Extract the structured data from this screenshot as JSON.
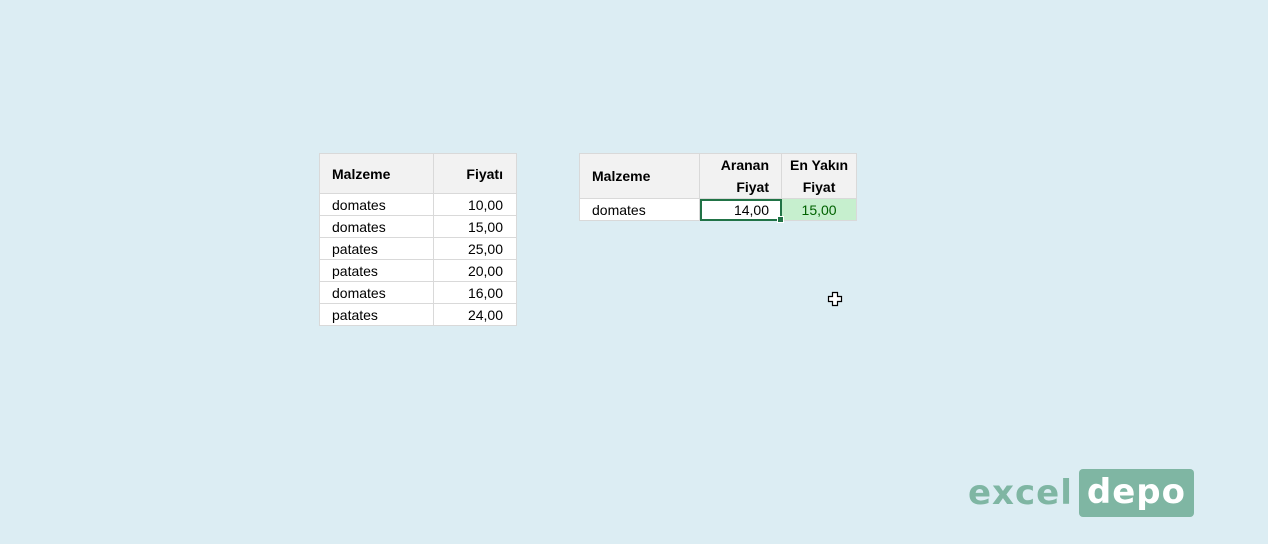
{
  "left_table": {
    "headers": [
      "Malzeme",
      "Fiyatı"
    ],
    "rows": [
      [
        "domates",
        "10,00"
      ],
      [
        "domates",
        "15,00"
      ],
      [
        "patates",
        "25,00"
      ],
      [
        "patates",
        "20,00"
      ],
      [
        "domates",
        "16,00"
      ],
      [
        "patates",
        "24,00"
      ]
    ]
  },
  "right_table": {
    "headers": {
      "malzeme": "Malzeme",
      "aranan_line1": "Aranan",
      "aranan_line2": "Fiyat",
      "enyakin_line1": "En Yakın",
      "enyakin_line2": "Fiyat"
    },
    "row": {
      "malzeme": "domates",
      "aranan": "14,00",
      "enyakin": "15,00"
    }
  },
  "logo": {
    "part1": "excel",
    "part2": "depo"
  },
  "colors": {
    "background": "#dcedf3",
    "selection": "#217346",
    "result_fill": "#c6efce",
    "logo": "#7fb6a3"
  },
  "icons": {
    "cursor": "cell-select-cross-cursor"
  }
}
